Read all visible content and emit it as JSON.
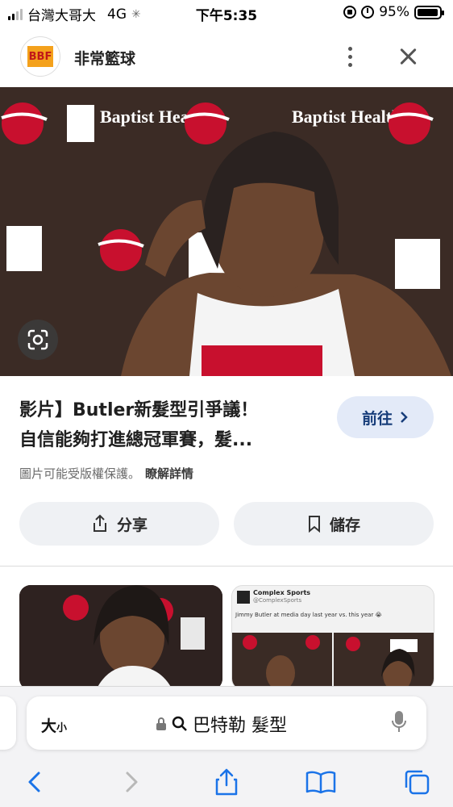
{
  "status_bar": {
    "carrier": "台灣大哥大",
    "network": "4G",
    "time": "下午5:35",
    "battery": "95%",
    "battery_level": 0.95
  },
  "header": {
    "site_logo_text": "BBF",
    "site_name": "非常籃球",
    "more_icon": "more-vertical-icon",
    "close_icon": "close-icon"
  },
  "image": {
    "sponsor_logo_text": "Baptist Health",
    "lens_icon": "google-lens-icon"
  },
  "result": {
    "title_line1": "影片】Butler新髮型引爭議！",
    "title_line2": "自信能夠打進總冠軍賽，髮...",
    "visit_label": "前往",
    "copyright_text": "圖片可能受版權保護。",
    "learn_more": "瞭解詳情"
  },
  "actions": {
    "share_label": "分享",
    "save_label": "儲存"
  },
  "related": {
    "tweet_account": "Complex Sports",
    "tweet_handle": "@ComplexSports",
    "tweet_text": "Jimmy Butler at media day last year vs. this year 😭"
  },
  "address_bar": {
    "text_size_label": "大",
    "text_size_small": "小",
    "query": "巴特勒 髮型"
  },
  "colors": {
    "accent_blue": "#1a73e8",
    "visit_bg": "#e3eaf8",
    "heat_red": "#c8102e"
  }
}
